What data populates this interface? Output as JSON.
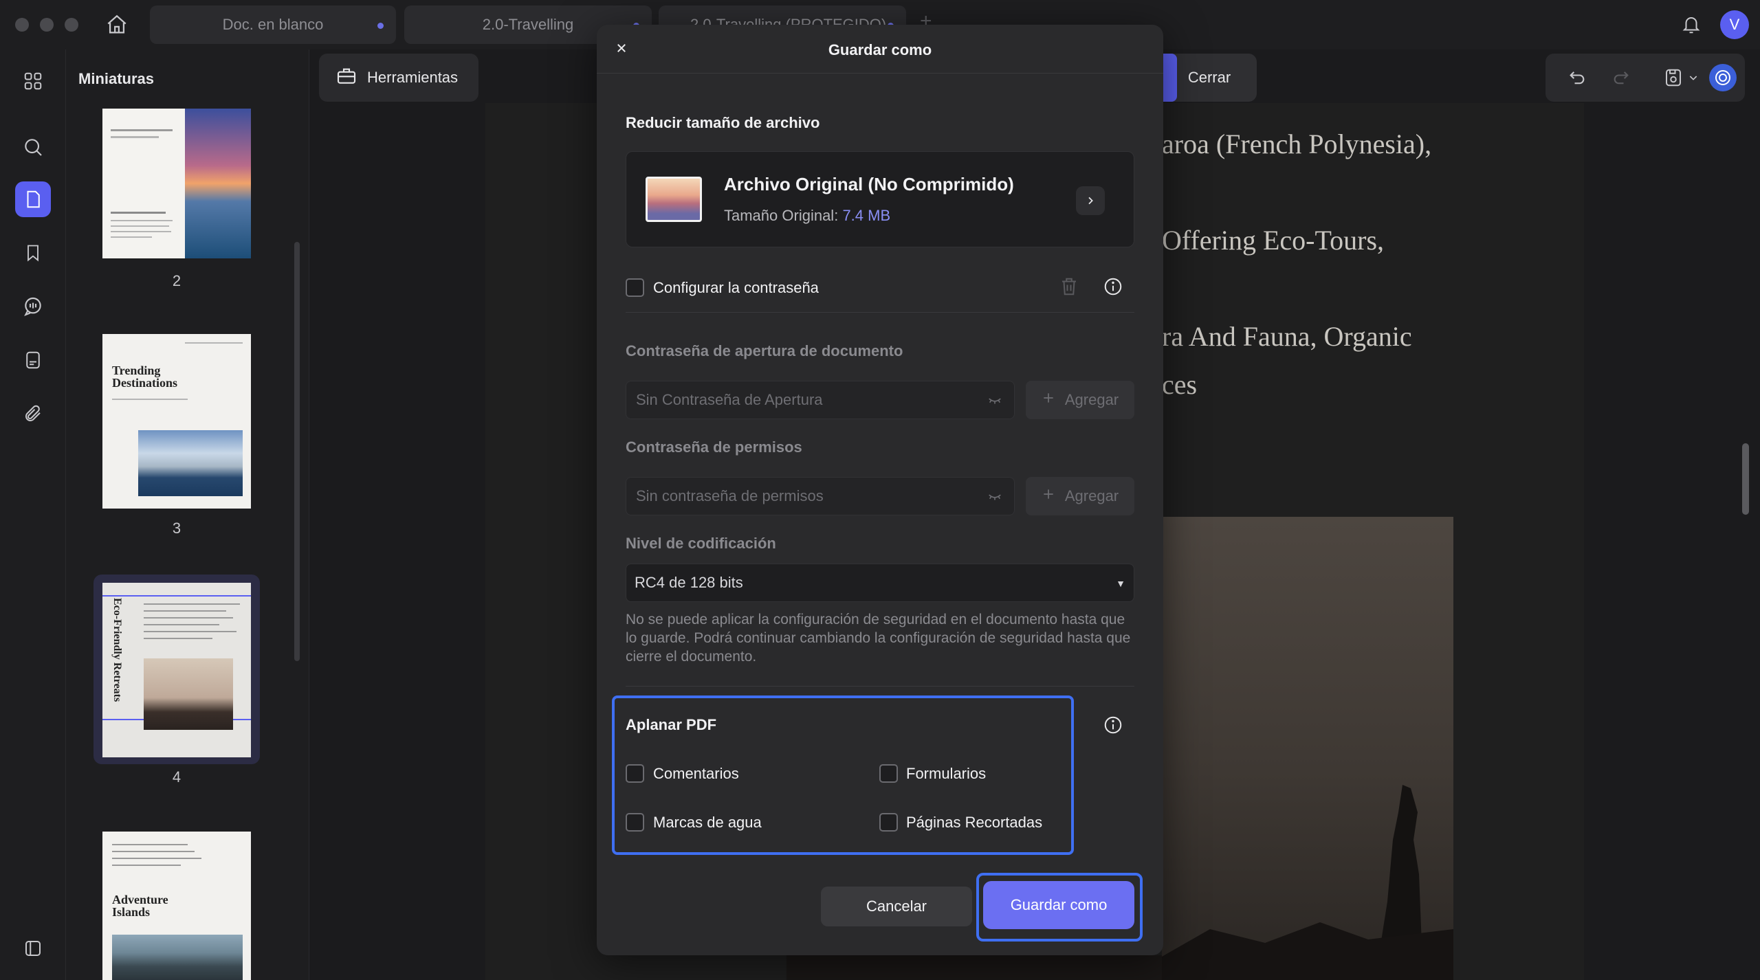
{
  "tabs": [
    {
      "label": "Doc. en blanco"
    },
    {
      "label": "2.0-Travelling"
    },
    {
      "label": "2.0-Travelling (PROTEGIDO)"
    }
  ],
  "user": {
    "initial": "V"
  },
  "panel": {
    "title": "Miniaturas",
    "pages": [
      {
        "number": "2"
      },
      {
        "number": "3",
        "title": "Trending Destinations"
      },
      {
        "number": "4",
        "title": "Eco-Friendly Retreats"
      },
      {
        "number": "",
        "title": "Adventure Islands"
      }
    ]
  },
  "toolbar": {
    "tools_label": "Herramientas",
    "close_label": "Cerrar"
  },
  "document": {
    "lines": [
      "aroa (French Polynesia),",
      "Offering Eco-Tours,",
      "ra And Fauna, Organic",
      "ces"
    ]
  },
  "dialog": {
    "title": "Guardar como",
    "reduce": {
      "title": "Reducir tamaño de archivo",
      "file_title": "Archivo Original (No Comprimido)",
      "size_label": "Tamaño Original:",
      "size_value": "7.4 MB"
    },
    "password": {
      "configure_label": "Configurar la contraseña",
      "open_label": "Contraseña de apertura de documento",
      "open_placeholder": "Sin Contraseña de Apertura",
      "permissions_label": "Contraseña de permisos",
      "permissions_placeholder": "Sin contraseña de permisos",
      "add_label": "Agregar",
      "encoding_label": "Nivel de codificación",
      "encoding_value": "RC4 de 128 bits",
      "note": "No se puede aplicar la configuración de seguridad en el documento hasta que lo guarde. Podrá continuar cambiando la configuración de seguridad hasta que cierre el documento."
    },
    "flatten": {
      "title": "Aplanar PDF",
      "options": [
        "Comentarios",
        "Formularios",
        "Marcas de agua",
        "Páginas Recortadas"
      ]
    },
    "cancel_label": "Cancelar",
    "save_label": "Guardar como"
  },
  "colors": {
    "accent": "#5a5ff0",
    "highlight": "#3f6ff2",
    "primary_button": "#6b6ff2"
  }
}
